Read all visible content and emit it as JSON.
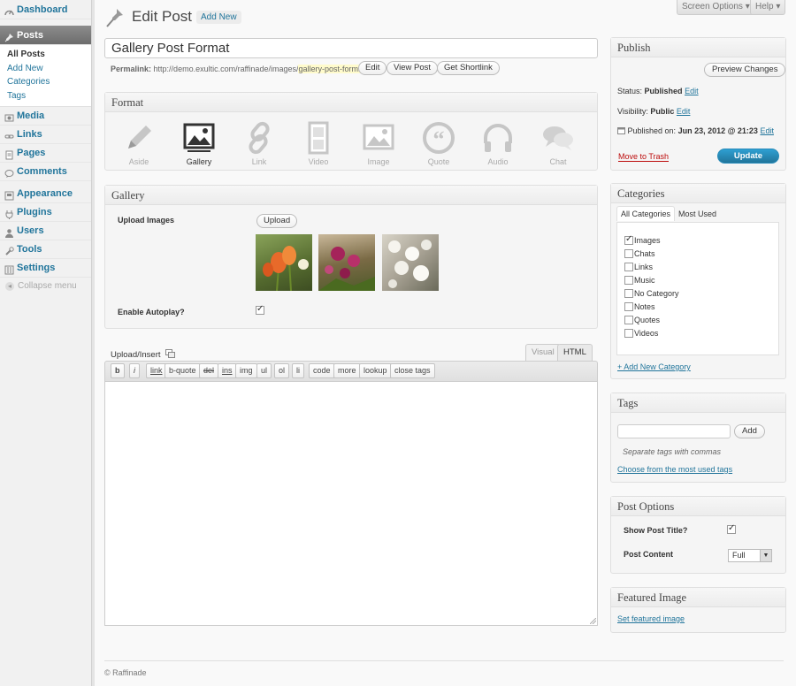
{
  "menu": {
    "dashboard": "Dashboard",
    "posts": "Posts",
    "posts_sub": [
      "All Posts",
      "Add New",
      "Categories",
      "Tags"
    ],
    "media": "Media",
    "links": "Links",
    "pages": "Pages",
    "comments": "Comments",
    "appearance": "Appearance",
    "plugins": "Plugins",
    "users": "Users",
    "tools": "Tools",
    "settings": "Settings",
    "collapse": "Collapse menu"
  },
  "header": {
    "title": "Edit Post",
    "add_new": "Add New",
    "screen_options": "Screen Options ▾",
    "help": "Help ▾"
  },
  "post": {
    "title": "Gallery Post Format",
    "permalink_label": "Permalink:",
    "permalink_base": "http://demo.exultic.com/raffinade/images/",
    "permalink_slug": "gallery-post-format",
    "edit": "Edit",
    "view_post": "View Post",
    "get_shortlink": "Get Shortlink"
  },
  "format": {
    "heading": "Format",
    "items": [
      "Aside",
      "Gallery",
      "Link",
      "Video",
      "Image",
      "Quote",
      "Audio",
      "Chat"
    ],
    "selected": "Gallery"
  },
  "gallery": {
    "heading": "Gallery",
    "upload_images": "Upload Images",
    "upload": "Upload",
    "enable_autoplay": "Enable Autoplay?",
    "autoplay": true
  },
  "editor": {
    "upload_insert": "Upload/Insert",
    "tab_visual": "Visual",
    "tab_html": "HTML",
    "buttons": [
      "b",
      "i",
      "link",
      "b-quote",
      "del",
      "ins",
      "img",
      "ul",
      "ol",
      "li",
      "code",
      "more",
      "lookup",
      "close tags"
    ]
  },
  "publish": {
    "heading": "Publish",
    "preview": "Preview Changes",
    "status_label": "Status:",
    "status": "Published",
    "visibility_label": "Visibility:",
    "visibility": "Public",
    "published_on_label": "Published on:",
    "published_on": "Jun 23, 2012 @ 21:23",
    "edit": "Edit",
    "trash": "Move to Trash",
    "update": "Update"
  },
  "categories": {
    "heading": "Categories",
    "tab_all": "All Categories",
    "tab_used": "Most Used",
    "items": [
      "Images",
      "Chats",
      "Links",
      "Music",
      "No Category",
      "Notes",
      "Quotes",
      "Videos"
    ],
    "checked": "Images",
    "add_new": "+ Add New Category"
  },
  "tags": {
    "heading": "Tags",
    "add": "Add",
    "hint": "Separate tags with commas",
    "choose": "Choose from the most used tags"
  },
  "post_options": {
    "heading": "Post Options",
    "show_title": "Show Post Title?",
    "show_title_checked": true,
    "post_content": "Post Content",
    "post_content_value": "Full"
  },
  "featured": {
    "heading": "Featured Image",
    "set": "Set featured image"
  },
  "footer": "© Raffinade",
  "colors": {
    "link": "#21759b",
    "update_button": "#21759b",
    "trash": "#bc0b0b"
  }
}
